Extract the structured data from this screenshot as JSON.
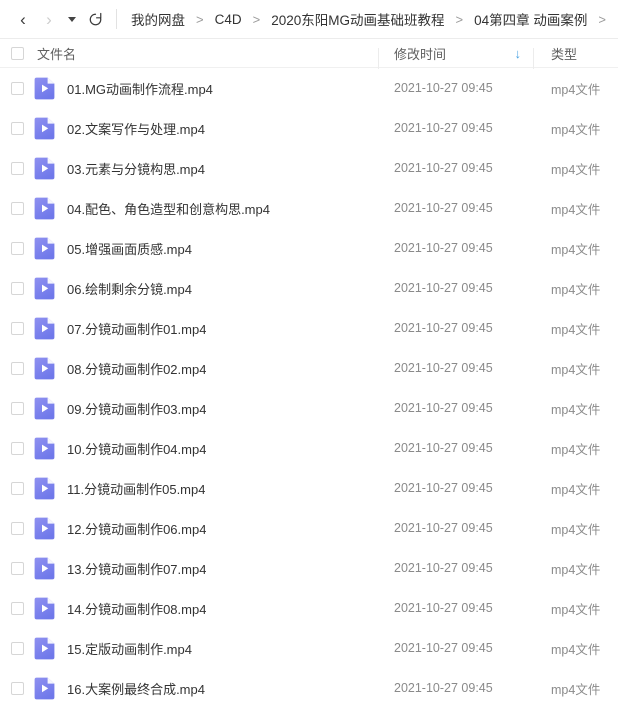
{
  "toolbar": {
    "back_icon": "chevron-left-icon",
    "back_glyph": "‹",
    "forward_icon": "chevron-right-icon",
    "forward_glyph": "›",
    "dropdown_icon": "caret-down-icon",
    "refresh_icon": "refresh-icon",
    "breadcrumb": [
      "我的网盘",
      "C4D",
      "2020东阳MG动画基础班教程",
      "04第四章 动画案例"
    ],
    "breadcrumb_separator": ">"
  },
  "columns": {
    "name": "文件名",
    "time": "修改时间",
    "type": "类型",
    "sort_glyph": "↓",
    "sort_column": "修改时间",
    "sort_direction": "descending"
  },
  "colors": {
    "accent_sort": "#4ba3e3",
    "file_icon_top": "#8f91f0",
    "file_icon_bottom": "#6f78ea",
    "text_primary": "#333333",
    "text_secondary": "#8a8a8a",
    "divider": "#ececec"
  },
  "files": [
    {
      "icon": "video-file-icon",
      "name": "01.MG动画制作流程.mp4",
      "time": "2021-10-27 09:45",
      "type": "mp4文件"
    },
    {
      "icon": "video-file-icon",
      "name": "02.文案写作与处理.mp4",
      "time": "2021-10-27 09:45",
      "type": "mp4文件"
    },
    {
      "icon": "video-file-icon",
      "name": "03.元素与分镜构思.mp4",
      "time": "2021-10-27 09:45",
      "type": "mp4文件"
    },
    {
      "icon": "video-file-icon",
      "name": "04.配色、角色造型和创意构思.mp4",
      "time": "2021-10-27 09:45",
      "type": "mp4文件"
    },
    {
      "icon": "video-file-icon",
      "name": "05.增强画面质感.mp4",
      "time": "2021-10-27 09:45",
      "type": "mp4文件"
    },
    {
      "icon": "video-file-icon",
      "name": "06.绘制剩余分镜.mp4",
      "time": "2021-10-27 09:45",
      "type": "mp4文件"
    },
    {
      "icon": "video-file-icon",
      "name": "07.分镜动画制作01.mp4",
      "time": "2021-10-27 09:45",
      "type": "mp4文件"
    },
    {
      "icon": "video-file-icon",
      "name": "08.分镜动画制作02.mp4",
      "time": "2021-10-27 09:45",
      "type": "mp4文件"
    },
    {
      "icon": "video-file-icon",
      "name": "09.分镜动画制作03.mp4",
      "time": "2021-10-27 09:45",
      "type": "mp4文件"
    },
    {
      "icon": "video-file-icon",
      "name": "10.分镜动画制作04.mp4",
      "time": "2021-10-27 09:45",
      "type": "mp4文件"
    },
    {
      "icon": "video-file-icon",
      "name": "11.分镜动画制作05.mp4",
      "time": "2021-10-27 09:45",
      "type": "mp4文件"
    },
    {
      "icon": "video-file-icon",
      "name": "12.分镜动画制作06.mp4",
      "time": "2021-10-27 09:45",
      "type": "mp4文件"
    },
    {
      "icon": "video-file-icon",
      "name": "13.分镜动画制作07.mp4",
      "time": "2021-10-27 09:45",
      "type": "mp4文件"
    },
    {
      "icon": "video-file-icon",
      "name": "14.分镜动画制作08.mp4",
      "time": "2021-10-27 09:45",
      "type": "mp4文件"
    },
    {
      "icon": "video-file-icon",
      "name": "15.定版动画制作.mp4",
      "time": "2021-10-27 09:45",
      "type": "mp4文件"
    },
    {
      "icon": "video-file-icon",
      "name": "16.大案例最终合成.mp4",
      "time": "2021-10-27 09:45",
      "type": "mp4文件"
    }
  ]
}
